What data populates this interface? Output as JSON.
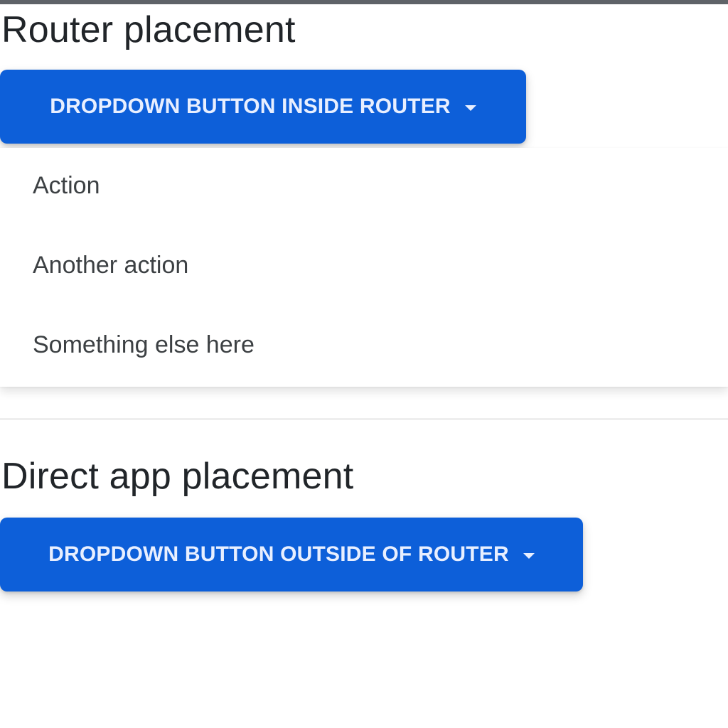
{
  "router_section": {
    "title": "Router placement",
    "button_label": "DROPDOWN BUTTON INSIDE ROUTER",
    "menu_items": [
      "Action",
      "Another action",
      "Something else here"
    ]
  },
  "direct_section": {
    "title": "Direct app placement",
    "button_label": "DROPDOWN BUTTON OUTSIDE OF ROUTER"
  },
  "colors": {
    "primary": "#0d5fd9",
    "button_text": "#e8efff",
    "text": "#212529"
  },
  "icons": {
    "button_caret": "caret-down-icon"
  }
}
